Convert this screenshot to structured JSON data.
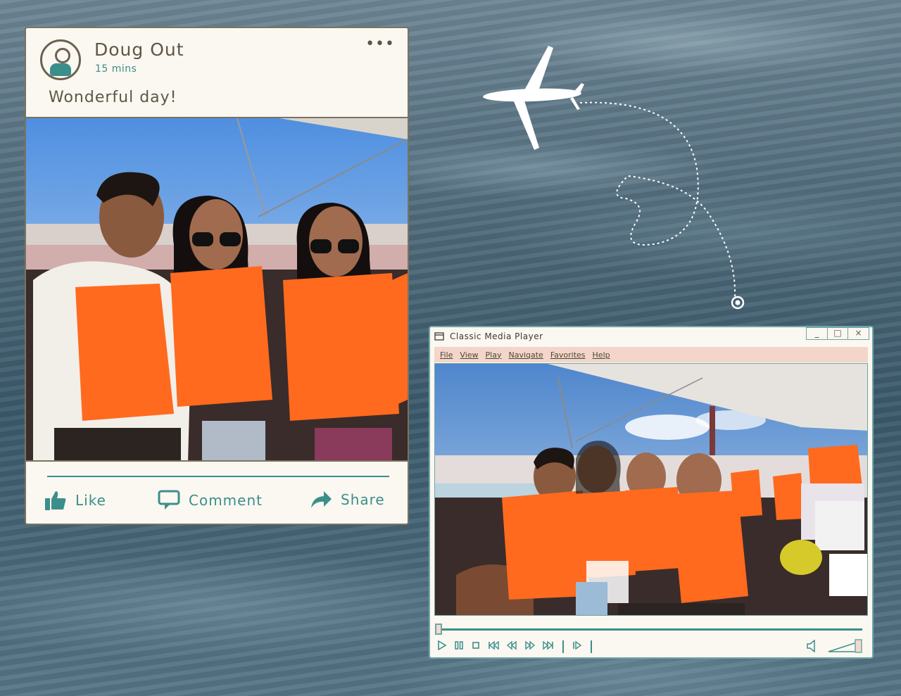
{
  "post": {
    "user_name": "Doug Out",
    "time": "15 mins",
    "caption": "Wonderful day!",
    "more_label": "•••",
    "actions": {
      "like": "Like",
      "comment": "Comment",
      "share": "Share"
    },
    "photo_description": "Three friends in orange life vests on a boat"
  },
  "media_player": {
    "title": "Classic Media Player",
    "window_controls": {
      "minimize": "_",
      "maximize": "□",
      "close": "×"
    },
    "menu": [
      "File",
      "View",
      "Play",
      "Navigate",
      "Favorites",
      "Help"
    ],
    "video_description": "Group in orange life vests on a boat",
    "seek_position": 0.0,
    "volume_level": 1.0
  },
  "colors": {
    "accent": "#3b8f8a",
    "window_border": "#6fa7a6",
    "menu_bg": "#f3d6c9",
    "card_bg": "#fbf7f1",
    "life_vest": "#ff6a1e"
  }
}
